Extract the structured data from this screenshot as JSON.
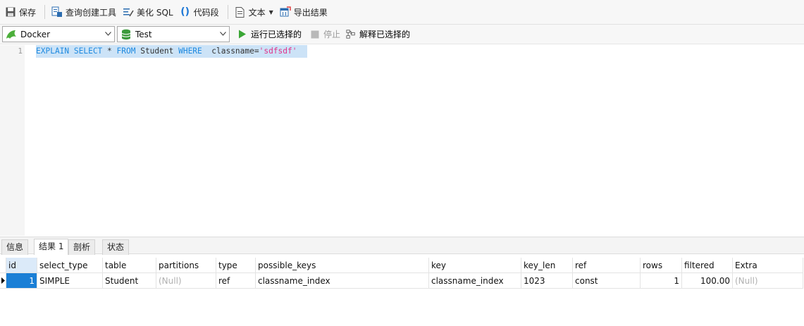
{
  "toolbar": {
    "save_label": "保存",
    "query_builder_label": "查询创建工具",
    "beautify_label": "美化 SQL",
    "snippet_label": "代码段",
    "text_label": "文本",
    "export_label": "导出结果"
  },
  "connection": {
    "connection_value": "Docker",
    "database_value": "Test",
    "run_selected_label": "运行已选择的",
    "stop_label": "停止",
    "explain_selected_label": "解释已选择的"
  },
  "editor": {
    "line_number": "1",
    "tokens": {
      "t1": "EXPLAIN SELECT",
      "t2": " * ",
      "t3": "FROM",
      "t4": " Student ",
      "t5": "WHERE",
      "t6": "  classname=",
      "t7": "'sdfsdf'"
    },
    "colors": {
      "keyword": "#1e8ae0",
      "string": "#e0318a",
      "selection": "#cce3f7"
    }
  },
  "result_tabs": [
    "信息",
    "结果 1",
    "剖析",
    "状态"
  ],
  "active_tab": "结果 1",
  "result_table": {
    "columns": [
      "id",
      "select_type",
      "table",
      "partitions",
      "type",
      "possible_keys",
      "key",
      "key_len",
      "ref",
      "rows",
      "filtered",
      "Extra"
    ],
    "rows": [
      [
        "1",
        "SIMPLE",
        "Student",
        "(Null)",
        "ref",
        "classname_index",
        "classname_index",
        "1023",
        "const",
        "1",
        "100.00",
        "(Null)"
      ]
    ]
  }
}
